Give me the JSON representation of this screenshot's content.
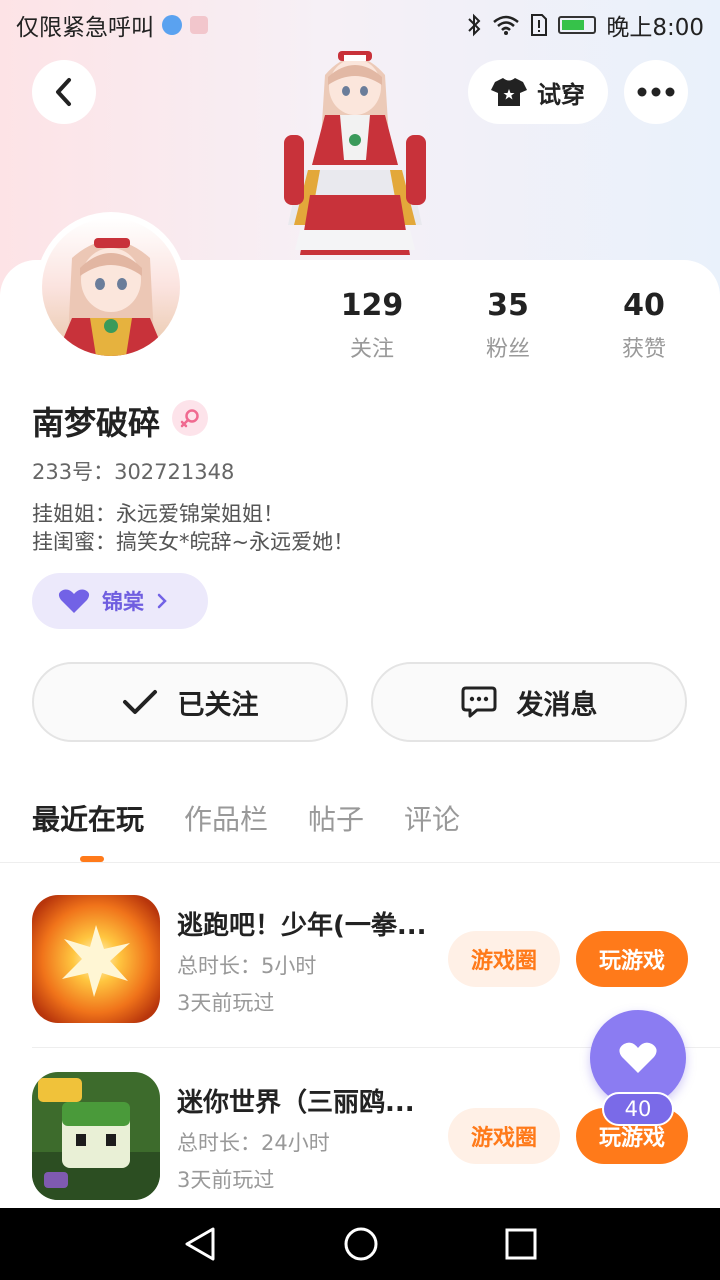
{
  "status_bar": {
    "carrier": "仅限紧急呼叫",
    "time": "晚上8:00"
  },
  "header": {
    "tryon_label": "试穿"
  },
  "profile": {
    "stats": [
      {
        "value": "129",
        "label": "关注"
      },
      {
        "value": "35",
        "label": "粉丝"
      },
      {
        "value": "40",
        "label": "获赞"
      }
    ],
    "username": "南梦破碎",
    "uid": "233号：302721348",
    "bio_lines": [
      "挂姐姐：永远爱锦棠姐姐！",
      "挂闺蜜：搞笑女*皖辞~永远爱她！"
    ],
    "tag_label": "锦棠"
  },
  "actions": {
    "followed_label": "已关注",
    "message_label": "发消息"
  },
  "tabs": [
    "最近在玩",
    "作品栏",
    "帖子",
    "评论"
  ],
  "games": [
    {
      "title": "逃跑吧！少年(一拳...",
      "duration": "总时长：5小时",
      "last_played": "3天前玩过",
      "circle_label": "游戏圈",
      "play_label": "玩游戏"
    },
    {
      "title": "迷你世界（三丽鸥...",
      "duration": "总时长：24小时",
      "last_played": "3天前玩过",
      "circle_label": "游戏圈",
      "play_label": "玩游戏"
    }
  ],
  "fab": {
    "count": "40"
  },
  "colors": {
    "accent_orange": "#ff7a1a",
    "accent_purple": "#8b7cf2",
    "tag_bg": "#ece9fb"
  }
}
